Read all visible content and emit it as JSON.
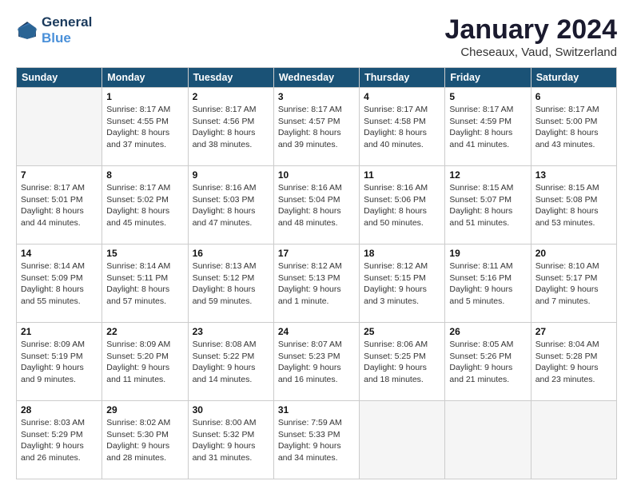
{
  "logo": {
    "line1": "General",
    "line2": "Blue"
  },
  "title": "January 2024",
  "subtitle": "Cheseaux, Vaud, Switzerland",
  "header_days": [
    "Sunday",
    "Monday",
    "Tuesday",
    "Wednesday",
    "Thursday",
    "Friday",
    "Saturday"
  ],
  "weeks": [
    [
      {
        "day": "",
        "info": ""
      },
      {
        "day": "1",
        "info": "Sunrise: 8:17 AM\nSunset: 4:55 PM\nDaylight: 8 hours\nand 37 minutes."
      },
      {
        "day": "2",
        "info": "Sunrise: 8:17 AM\nSunset: 4:56 PM\nDaylight: 8 hours\nand 38 minutes."
      },
      {
        "day": "3",
        "info": "Sunrise: 8:17 AM\nSunset: 4:57 PM\nDaylight: 8 hours\nand 39 minutes."
      },
      {
        "day": "4",
        "info": "Sunrise: 8:17 AM\nSunset: 4:58 PM\nDaylight: 8 hours\nand 40 minutes."
      },
      {
        "day": "5",
        "info": "Sunrise: 8:17 AM\nSunset: 4:59 PM\nDaylight: 8 hours\nand 41 minutes."
      },
      {
        "day": "6",
        "info": "Sunrise: 8:17 AM\nSunset: 5:00 PM\nDaylight: 8 hours\nand 43 minutes."
      }
    ],
    [
      {
        "day": "7",
        "info": "Sunrise: 8:17 AM\nSunset: 5:01 PM\nDaylight: 8 hours\nand 44 minutes."
      },
      {
        "day": "8",
        "info": "Sunrise: 8:17 AM\nSunset: 5:02 PM\nDaylight: 8 hours\nand 45 minutes."
      },
      {
        "day": "9",
        "info": "Sunrise: 8:16 AM\nSunset: 5:03 PM\nDaylight: 8 hours\nand 47 minutes."
      },
      {
        "day": "10",
        "info": "Sunrise: 8:16 AM\nSunset: 5:04 PM\nDaylight: 8 hours\nand 48 minutes."
      },
      {
        "day": "11",
        "info": "Sunrise: 8:16 AM\nSunset: 5:06 PM\nDaylight: 8 hours\nand 50 minutes."
      },
      {
        "day": "12",
        "info": "Sunrise: 8:15 AM\nSunset: 5:07 PM\nDaylight: 8 hours\nand 51 minutes."
      },
      {
        "day": "13",
        "info": "Sunrise: 8:15 AM\nSunset: 5:08 PM\nDaylight: 8 hours\nand 53 minutes."
      }
    ],
    [
      {
        "day": "14",
        "info": "Sunrise: 8:14 AM\nSunset: 5:09 PM\nDaylight: 8 hours\nand 55 minutes."
      },
      {
        "day": "15",
        "info": "Sunrise: 8:14 AM\nSunset: 5:11 PM\nDaylight: 8 hours\nand 57 minutes."
      },
      {
        "day": "16",
        "info": "Sunrise: 8:13 AM\nSunset: 5:12 PM\nDaylight: 8 hours\nand 59 minutes."
      },
      {
        "day": "17",
        "info": "Sunrise: 8:12 AM\nSunset: 5:13 PM\nDaylight: 9 hours\nand 1 minute."
      },
      {
        "day": "18",
        "info": "Sunrise: 8:12 AM\nSunset: 5:15 PM\nDaylight: 9 hours\nand 3 minutes."
      },
      {
        "day": "19",
        "info": "Sunrise: 8:11 AM\nSunset: 5:16 PM\nDaylight: 9 hours\nand 5 minutes."
      },
      {
        "day": "20",
        "info": "Sunrise: 8:10 AM\nSunset: 5:17 PM\nDaylight: 9 hours\nand 7 minutes."
      }
    ],
    [
      {
        "day": "21",
        "info": "Sunrise: 8:09 AM\nSunset: 5:19 PM\nDaylight: 9 hours\nand 9 minutes."
      },
      {
        "day": "22",
        "info": "Sunrise: 8:09 AM\nSunset: 5:20 PM\nDaylight: 9 hours\nand 11 minutes."
      },
      {
        "day": "23",
        "info": "Sunrise: 8:08 AM\nSunset: 5:22 PM\nDaylight: 9 hours\nand 14 minutes."
      },
      {
        "day": "24",
        "info": "Sunrise: 8:07 AM\nSunset: 5:23 PM\nDaylight: 9 hours\nand 16 minutes."
      },
      {
        "day": "25",
        "info": "Sunrise: 8:06 AM\nSunset: 5:25 PM\nDaylight: 9 hours\nand 18 minutes."
      },
      {
        "day": "26",
        "info": "Sunrise: 8:05 AM\nSunset: 5:26 PM\nDaylight: 9 hours\nand 21 minutes."
      },
      {
        "day": "27",
        "info": "Sunrise: 8:04 AM\nSunset: 5:28 PM\nDaylight: 9 hours\nand 23 minutes."
      }
    ],
    [
      {
        "day": "28",
        "info": "Sunrise: 8:03 AM\nSunset: 5:29 PM\nDaylight: 9 hours\nand 26 minutes."
      },
      {
        "day": "29",
        "info": "Sunrise: 8:02 AM\nSunset: 5:30 PM\nDaylight: 9 hours\nand 28 minutes."
      },
      {
        "day": "30",
        "info": "Sunrise: 8:00 AM\nSunset: 5:32 PM\nDaylight: 9 hours\nand 31 minutes."
      },
      {
        "day": "31",
        "info": "Sunrise: 7:59 AM\nSunset: 5:33 PM\nDaylight: 9 hours\nand 34 minutes."
      },
      {
        "day": "",
        "info": ""
      },
      {
        "day": "",
        "info": ""
      },
      {
        "day": "",
        "info": ""
      }
    ]
  ]
}
